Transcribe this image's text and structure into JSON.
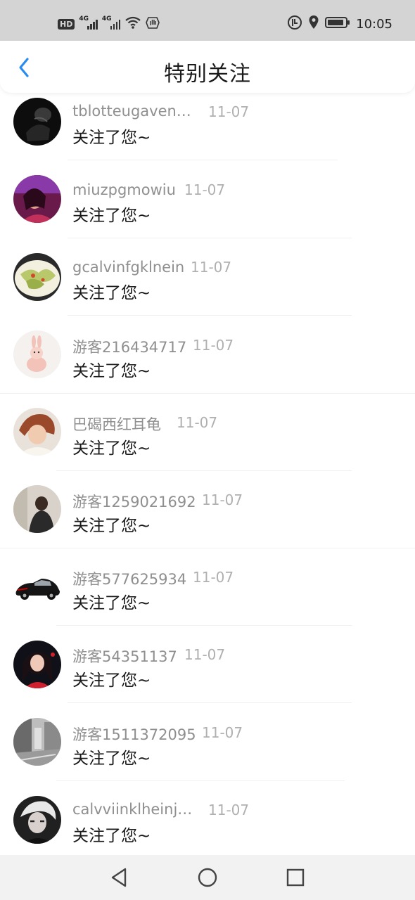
{
  "status_bar": {
    "hd_label": "HD",
    "signal_tag": "4G",
    "time": "10:05",
    "icons": [
      "hd-icon",
      "signal-icon",
      "signal-icon",
      "wifi-icon",
      "hand-icon",
      "data-saver-icon",
      "location-icon",
      "battery-icon"
    ]
  },
  "header": {
    "title": "特别关注",
    "back_icon": "chevron-left-icon",
    "accent_color": "#2a8cf0"
  },
  "list": {
    "items": [
      {
        "name": "tblotteugaven…",
        "date": "11-07",
        "message": "关注了您~"
      },
      {
        "name": "miuzpgmowiu",
        "date": "11-07",
        "message": "关注了您~"
      },
      {
        "name": "gcalvinfgklnein",
        "date": "11-07",
        "message": "关注了您~"
      },
      {
        "name": "游客216434717",
        "date": "11-07",
        "message": "关注了您~"
      },
      {
        "name": "巴碣西红耳龟",
        "date": "11-07",
        "message": "关注了您~"
      },
      {
        "name": "游客1259021692",
        "date": "11-07",
        "message": "关注了您~"
      },
      {
        "name": "游客577625934",
        "date": "11-07",
        "message": "关注了您~"
      },
      {
        "name": "游客54351137",
        "date": "11-07",
        "message": "关注了您~"
      },
      {
        "name": "游客1511372095",
        "date": "11-07",
        "message": "关注了您~"
      },
      {
        "name": "calvviinklheinj…",
        "date": "11-07",
        "message": "关注了您~"
      }
    ]
  },
  "nav_bar": {
    "icons": [
      "back-triangle-icon",
      "home-circle-icon",
      "recents-square-icon"
    ]
  }
}
